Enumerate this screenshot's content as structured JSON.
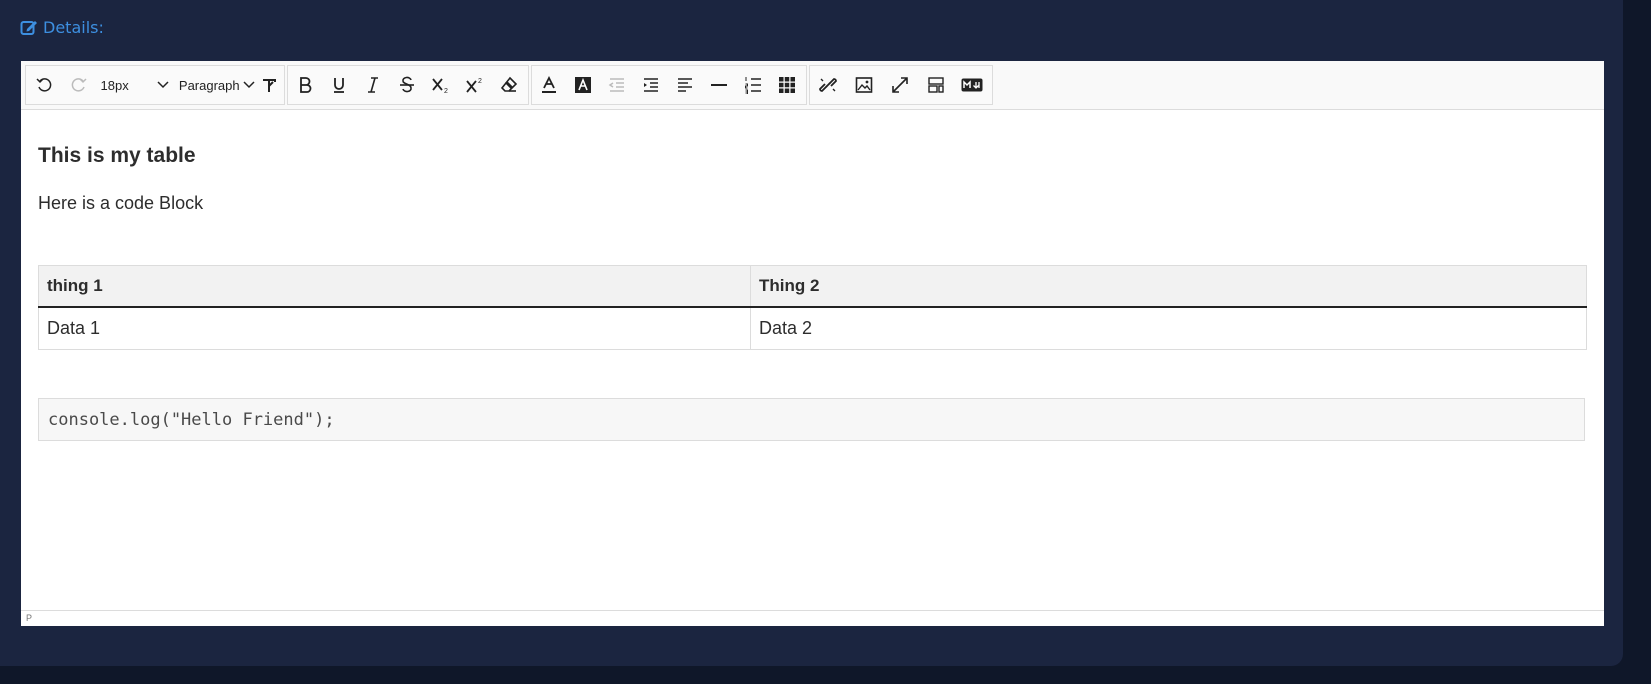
{
  "details": {
    "label": "Details:"
  },
  "toolbar": {
    "font_size": "18px",
    "block_format": "Paragraph"
  },
  "document": {
    "heading": "This is my table",
    "paragraph": "Here is a code Block",
    "table": {
      "headers": [
        "thing 1",
        "Thing 2"
      ],
      "rows": [
        [
          "Data 1",
          "Data 2"
        ]
      ]
    },
    "code": "console.log(\"Hello Friend\");"
  },
  "status": {
    "path": "P"
  }
}
